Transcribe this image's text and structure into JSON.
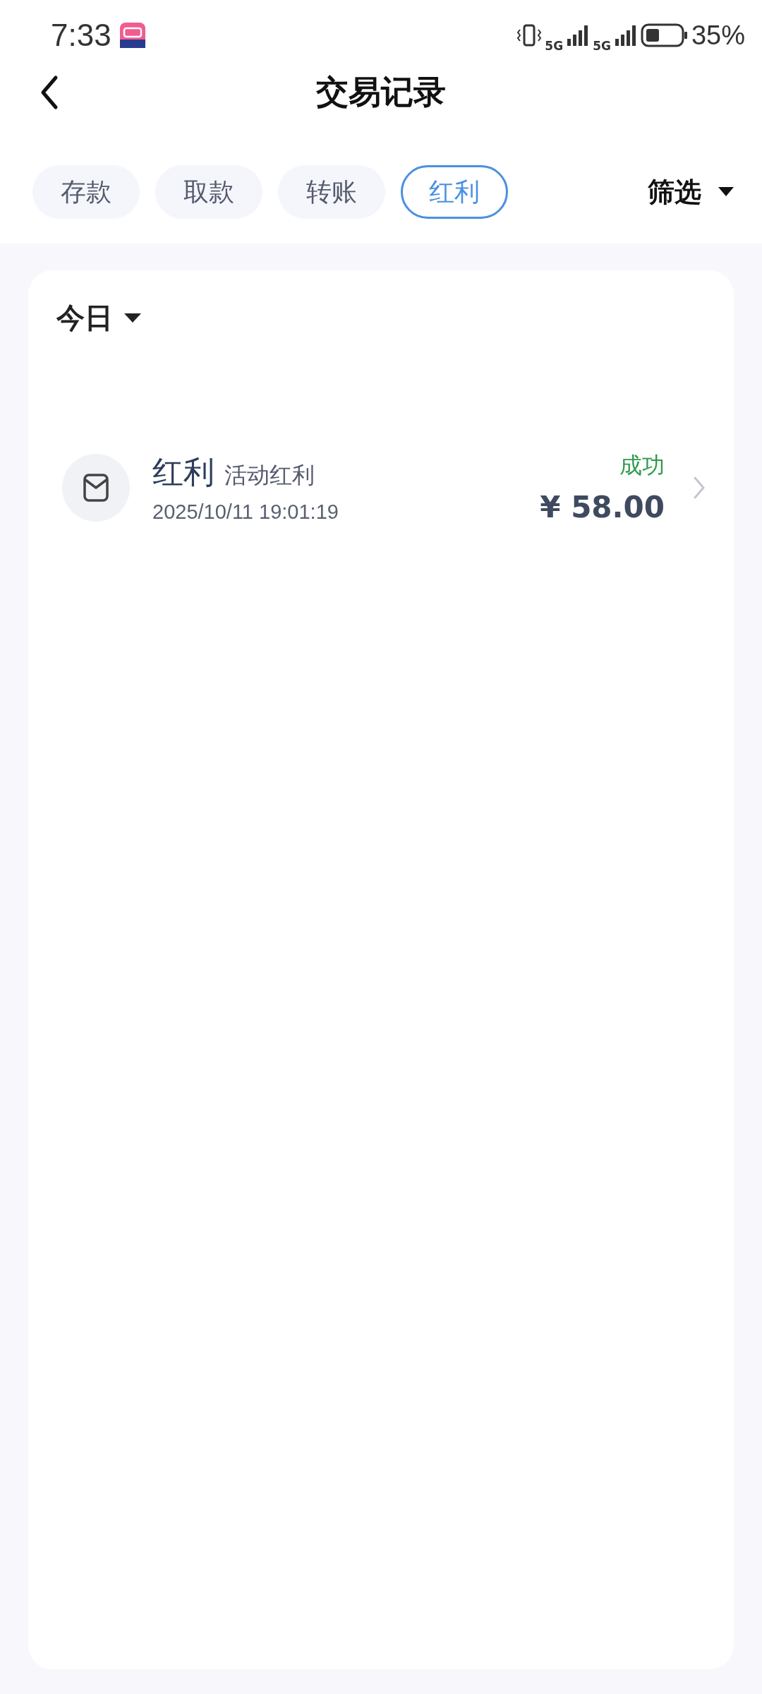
{
  "status_bar": {
    "time": "7:33",
    "network_1": "5G",
    "network_2": "5G",
    "battery": "35%"
  },
  "header": {
    "title": "交易记录"
  },
  "tabs": [
    {
      "label": "存款",
      "selected": false
    },
    {
      "label": "取款",
      "selected": false
    },
    {
      "label": "转账",
      "selected": false
    },
    {
      "label": "红利",
      "selected": true
    }
  ],
  "filter": {
    "label": "筛选"
  },
  "date_filter": {
    "label": "今日"
  },
  "records": [
    {
      "type": "红利",
      "subtype": "活动红利",
      "datetime": "2025/10/11 19:01:19",
      "status": "成功",
      "amount": "¥ 58.00"
    }
  ]
}
